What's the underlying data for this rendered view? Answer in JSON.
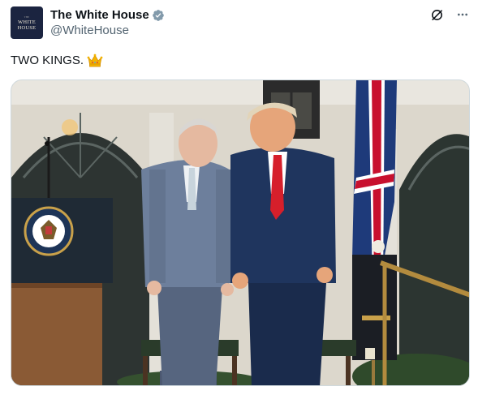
{
  "account": {
    "avatar_text_line1": "THE",
    "avatar_text_line2": "WHITE",
    "avatar_text_line3": "HOUSE",
    "display_name": "The White House",
    "handle": "@WhiteHouse",
    "verified_icon": "verified-badge-icon",
    "verified_color": "#829aab"
  },
  "actions": {
    "grok_icon": "grok-slash-circle-icon",
    "more_icon": "more-dots-icon"
  },
  "tweet": {
    "text": "TWO KINGS.",
    "emoji": "crown-emoji"
  },
  "media": {
    "type": "photo",
    "alt": ""
  }
}
